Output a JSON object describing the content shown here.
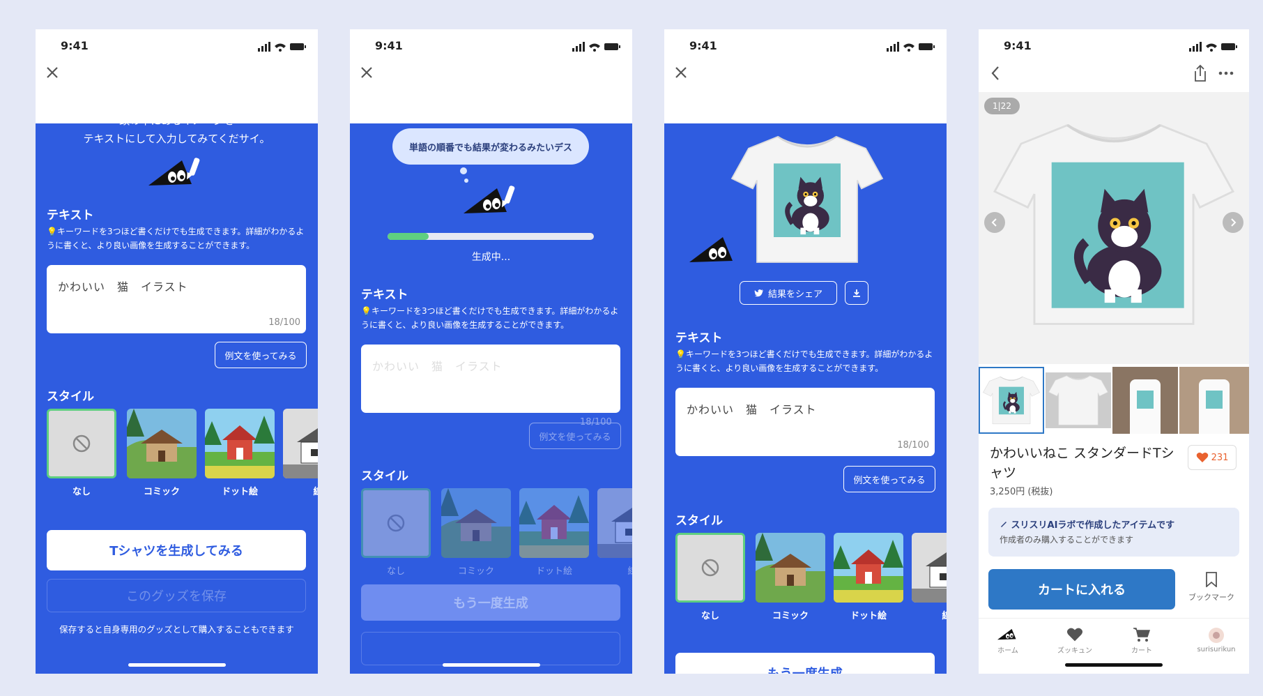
{
  "status_time": "9:41",
  "common": {
    "text_label": "テキスト",
    "hint": "キーワードを3つほど書くだけでも生成できます。詳細がわかるように書くと、より良い画像を生成することができます。",
    "textarea_value": "かわいい　猫　イラスト",
    "textarea_placeholder": "かわいい　猫　イラスト",
    "char_count": "18/100",
    "example_button": "例文を使ってみる",
    "style_label": "スタイル",
    "styles": [
      "なし",
      "コミック",
      "ドット絵",
      "線"
    ]
  },
  "screen1": {
    "intro_line1": "頭の中にあるイメージを",
    "intro_line2": "テキストにして入力してみてくだサイ。",
    "generate_button": "Tシャツを生成してみる",
    "save_button": "このグッズを保存",
    "save_note": "保存すると自身専用のグッズとして購入することもできます"
  },
  "screen2": {
    "bubble": "単語の順番でも結果が変わるみたいデス",
    "progress": 0.2,
    "progress_text": "生成中...",
    "regenerate_button": "もう一度生成"
  },
  "screen3": {
    "share_button": "結果をシェア",
    "regenerate_button": "もう一度生成"
  },
  "screen4": {
    "image_counter": "1|22",
    "product_title": "かわいいねこ スタンダードTシャツ",
    "like_count": "231",
    "price": "3,250円 (税抜)",
    "notice_title": "スリスリAIラボで作成したアイテムです",
    "notice_sub": "作成者のみ購入することができます",
    "cart_button": "カートに入れる",
    "bookmark_label": "ブックマーク",
    "nav": [
      "ホーム",
      "ズッキュン",
      "カート",
      "surisurikun"
    ]
  },
  "colors": {
    "brand_blue": "#2f5ce0",
    "selected_green": "#5fcf80",
    "cart_blue": "#2e78c6",
    "heart": "#e9622f"
  }
}
